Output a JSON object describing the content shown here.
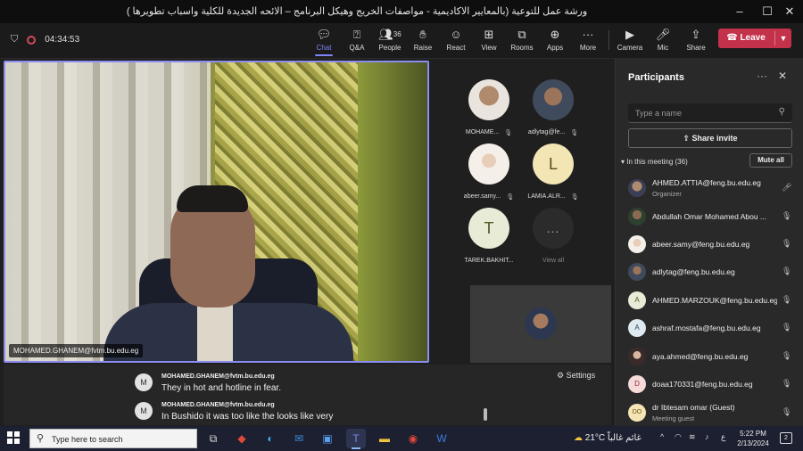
{
  "window": {
    "title": "ورشة عمل للتوعية (بالمعايير الاكاديمية - مواصفات الخريج وهيكل البرنامج – الائحه الجديدة للكلية واسباب تطويرها )",
    "controls": [
      "–",
      "☐",
      "✕"
    ]
  },
  "toolbar": {
    "timer": "04:34:53",
    "buttons": [
      {
        "id": "chat",
        "label": "Chat",
        "icon": "chat-icon",
        "active": true
      },
      {
        "id": "qa",
        "label": "Q&A",
        "icon": "qa-icon"
      },
      {
        "id": "people",
        "label": "People",
        "icon": "people-icon",
        "count": "36"
      },
      {
        "id": "raise",
        "label": "Raise",
        "icon": "raise-hand-icon"
      },
      {
        "id": "react",
        "label": "React",
        "icon": "react-icon"
      },
      {
        "id": "view",
        "label": "View",
        "icon": "view-icon"
      },
      {
        "id": "rooms",
        "label": "Rooms",
        "icon": "rooms-icon"
      },
      {
        "id": "apps",
        "label": "Apps",
        "icon": "apps-icon"
      },
      {
        "id": "more",
        "label": "More",
        "icon": "more-icon"
      },
      {
        "id": "camera",
        "label": "Camera",
        "icon": "camera-off-icon"
      },
      {
        "id": "mic",
        "label": "Mic",
        "icon": "mic-icon"
      },
      {
        "id": "share",
        "label": "Share",
        "icon": "share-icon"
      }
    ],
    "leave_label": "Leave",
    "leave_color": "#c4314b"
  },
  "main_video": {
    "name": "MOHAMED.GHANEM@fvtm.bu.edu.eg",
    "border_color": "#8b8cf0"
  },
  "grid": [
    {
      "name": "MOHAME...",
      "avatar": "photo"
    },
    {
      "name": "adlytag@fe...",
      "avatar": "photo"
    },
    {
      "name": "abeer.samy...",
      "avatar": "photo"
    },
    {
      "name": "LAMIA.ALR...",
      "avatar": "L"
    },
    {
      "name": "TAREK.BAKHIT...",
      "avatar": "T"
    },
    {
      "name": "View all",
      "avatar": "..."
    }
  ],
  "captions": {
    "settings_label": "Settings",
    "lines": [
      {
        "initial": "M",
        "name": "MOHAMED.GHANEM@fvtm.bu.edu.eg",
        "text": "They in hot and hotline in fear."
      },
      {
        "initial": "M",
        "name": "MOHAMED.GHANEM@fvtm.bu.edu.eg",
        "text": "In Bushido it was too like the looks like very"
      }
    ]
  },
  "participants": {
    "title": "Participants",
    "search_placeholder": "Type a name",
    "share_invite": "Share invite",
    "section_label": "In this meeting (36)",
    "mute_all": "Mute all",
    "list": [
      {
        "name": "AHMED.ATTIA@feng.bu.edu.eg",
        "role": "Organizer",
        "avatar": "photo",
        "mic": "on"
      },
      {
        "name": "Abdullah Omar Mohamed Abou ...",
        "role": "",
        "avatar": "photo",
        "mic": "muted"
      },
      {
        "name": "abeer.samy@feng.bu.edu.eg",
        "role": "",
        "avatar": "photo",
        "mic": "muted"
      },
      {
        "name": "adlytag@feng.bu.edu.eg",
        "role": "",
        "avatar": "photo",
        "mic": "muted"
      },
      {
        "name": "AHMED.MARZOUK@feng.bu.edu.eg",
        "role": "",
        "avatar": "A",
        "mic": "muted"
      },
      {
        "name": "ashraf.mostafa@feng.bu.edu.eg",
        "role": "",
        "avatar": "A",
        "mic": "muted"
      },
      {
        "name": "aya.ahmed@feng.bu.edu.eg",
        "role": "",
        "avatar": "photo",
        "mic": "muted"
      },
      {
        "name": "doaa170331@feng.bu.edu.eg",
        "role": "",
        "avatar": "D",
        "mic": "muted"
      },
      {
        "name": "dr Ibtesam omar (Guest)",
        "role": "Meeting guest",
        "avatar": "DO",
        "mic": "muted"
      }
    ]
  },
  "taskbar": {
    "search_placeholder": "Type here to search",
    "weather": "21°C",
    "weather_desc": "غائم غالباً",
    "lang": "ع",
    "time": "5:22 PM",
    "date": "2/13/2024",
    "notifications": "2"
  }
}
